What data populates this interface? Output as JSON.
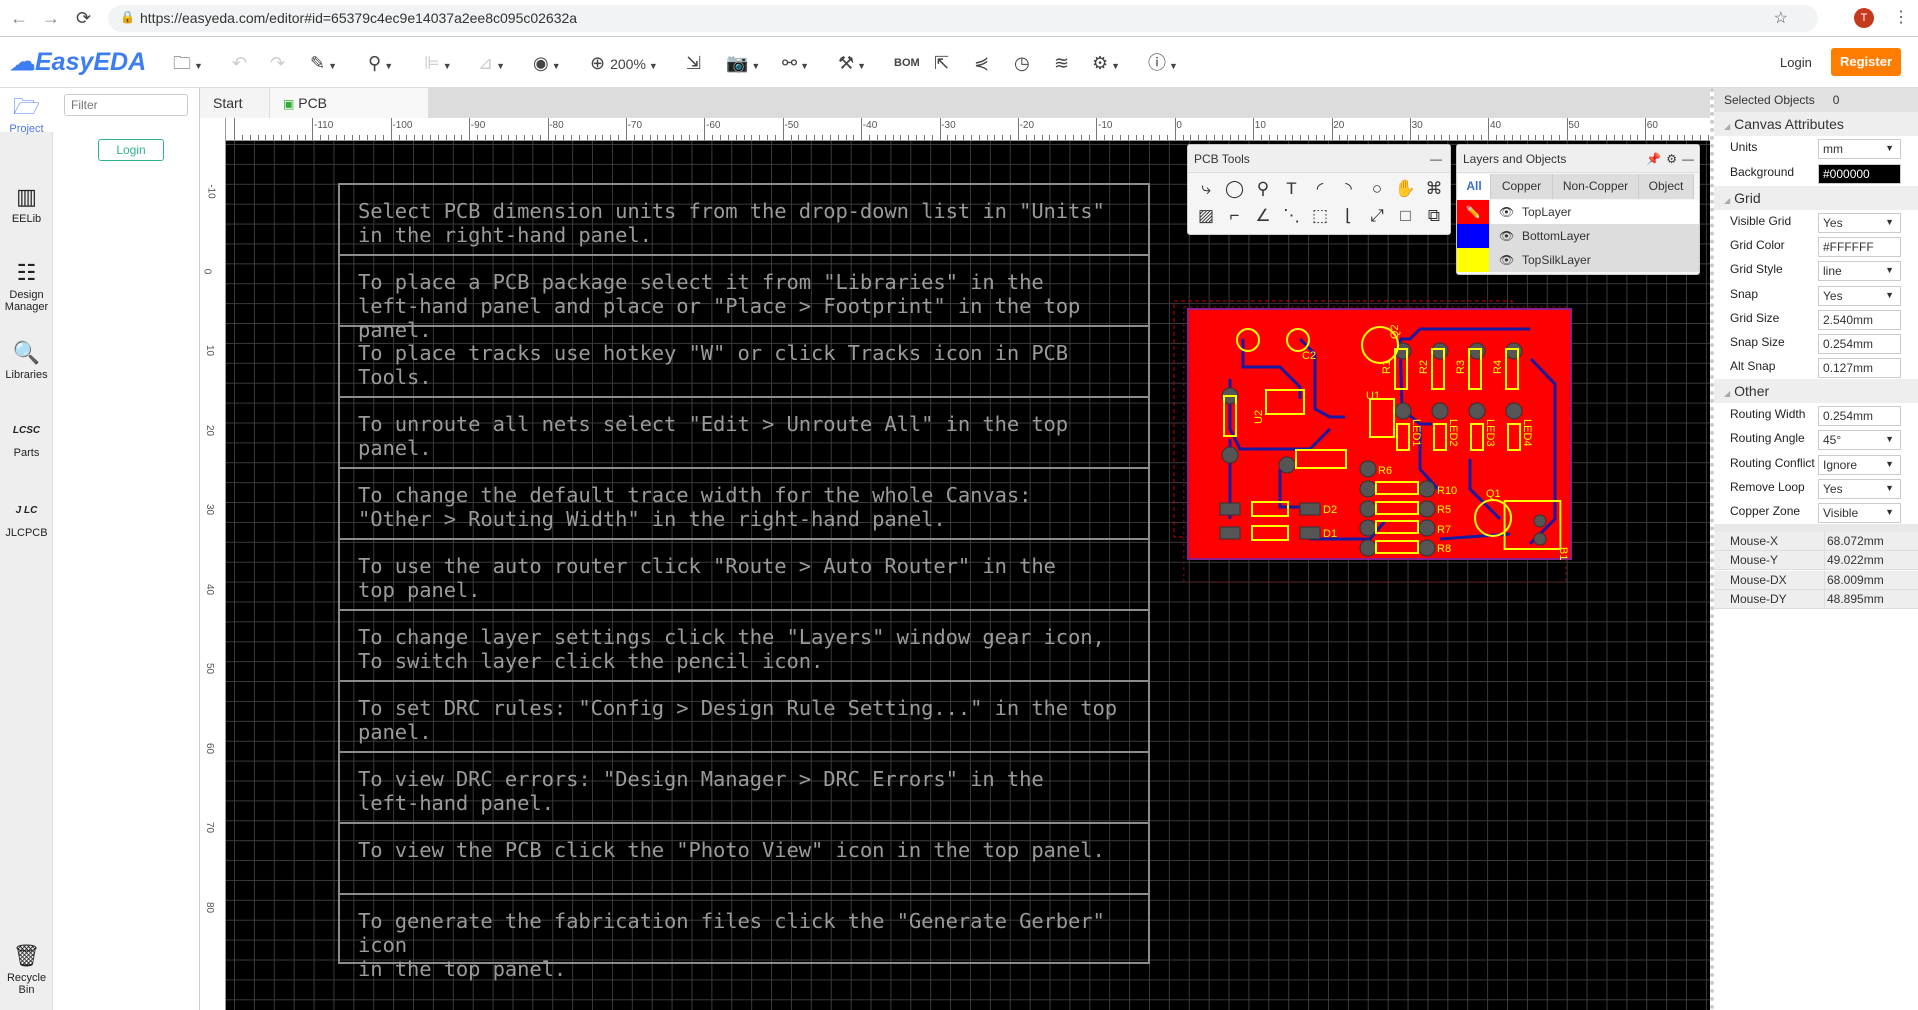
{
  "browser": {
    "url": "https://easyeda.com/editor#id=65379c4ec9e14037a2ee8c095c02632a",
    "avatar": "T"
  },
  "toolbar": {
    "logo": "EasyEDA",
    "zoom": "200%",
    "bom": "BOM",
    "login": "Login",
    "register": "Register"
  },
  "sidebar": {
    "items": [
      {
        "label": "Project",
        "icon": "folder-icon"
      },
      {
        "label": "EELib",
        "icon": "chip-icon"
      },
      {
        "label": "Design Manager",
        "icon": "design-manager-icon"
      },
      {
        "label": "Libraries",
        "icon": "libraries-icon"
      },
      {
        "label": "Parts",
        "icon": "lcsc-icon"
      },
      {
        "label": "JLCPCB",
        "icon": "jlc-icon"
      },
      {
        "label": "Recycle Bin",
        "icon": "trash-icon"
      }
    ],
    "filter_placeholder": "Filter",
    "login": "Login"
  },
  "tabs": [
    {
      "label": "Start"
    },
    {
      "label": "PCB"
    }
  ],
  "ruler": {
    "x_ticks": [
      -110,
      -100,
      -90,
      -80,
      -70,
      -60,
      -50,
      -40,
      -30,
      -20,
      -10,
      0,
      10,
      20,
      30,
      40,
      50,
      60
    ],
    "y_ticks": [
      -10,
      0,
      10,
      20,
      30,
      40,
      50,
      60,
      70,
      80
    ]
  },
  "tips": [
    "Select PCB dimension units from the drop-down list in \"Units\"\nin the right-hand panel.",
    "To place a PCB package select it from \"Libraries\" in the\nleft-hand panel and place or \"Place > Footprint\" in the top panel.",
    "To place tracks use hotkey \"W\" or click Tracks icon in PCB Tools.",
    "To unroute all nets select \"Edit > Unroute All\" in the top panel.",
    "To change the default trace width for the whole Canvas:\n\"Other > Routing Width\" in the right-hand panel.",
    "To use the auto router click \"Route > Auto Router\" in the\ntop panel.",
    "To change layer settings click the \"Layers\" window gear icon,\nTo switch layer click the pencil icon.",
    "To set DRC rules: \"Config > Design Rule Setting...\" in the top\npanel.",
    "To view DRC errors: \"Design Manager > DRC Errors\" in the\nleft-hand panel.",
    "To view the PCB click the \"Photo View\" icon in the top panel.",
    "To generate the fabrication files click the \"Generate Gerber\" icon\nin the top panel."
  ],
  "pcb_tools": {
    "title": "PCB Tools"
  },
  "layers": {
    "title": "Layers and Objects",
    "tabs": [
      "All",
      "Copper",
      "Non-Copper",
      "Object"
    ],
    "rows": [
      {
        "name": "TopLayer",
        "color": "#FF0000"
      },
      {
        "name": "BottomLayer",
        "color": "#0000FF"
      },
      {
        "name": "TopSilkLayer",
        "color": "#FFFF00"
      }
    ]
  },
  "pcb": {
    "labels": [
      "C2",
      "Q2",
      "U1",
      "U2",
      "R1",
      "R2",
      "R3",
      "R4",
      "LED1",
      "LED2",
      "LED3",
      "LED4",
      "R6",
      "R10",
      "R5",
      "R7",
      "R8",
      "D2",
      "D1",
      "Q1",
      "B1"
    ],
    "board_color": "#FF0000",
    "silk_color": "#FFFF00",
    "track_color": "#1a1aa0"
  },
  "right": {
    "selected_label": "Selected Objects",
    "selected_count": "0",
    "canvas_header": "Canvas Attributes",
    "units_label": "Units",
    "units": "mm",
    "background_label": "Background",
    "background": "#000000",
    "grid_header": "Grid",
    "visible_grid_label": "Visible Grid",
    "visible_grid": "Yes",
    "grid_color_label": "Grid Color",
    "grid_color": "#FFFFFF",
    "grid_style_label": "Grid Style",
    "grid_style": "line",
    "snap_label": "Snap",
    "snap": "Yes",
    "grid_size_label": "Grid Size",
    "grid_size": "2.540mm",
    "snap_size_label": "Snap Size",
    "snap_size": "0.254mm",
    "alt_snap_label": "Alt Snap",
    "alt_snap": "0.127mm",
    "other_header": "Other",
    "routing_width_label": "Routing Width",
    "routing_width": "0.254mm",
    "routing_angle_label": "Routing Angle",
    "routing_angle": "45°",
    "routing_conflict_label": "Routing Conflict",
    "routing_conflict": "Ignore",
    "remove_loop_label": "Remove Loop",
    "remove_loop": "Yes",
    "copper_zone_label": "Copper Zone",
    "copper_zone": "Visible",
    "mouse": [
      {
        "k": "Mouse-X",
        "v": "68.072mm"
      },
      {
        "k": "Mouse-Y",
        "v": "49.022mm"
      },
      {
        "k": "Mouse-DX",
        "v": "68.009mm"
      },
      {
        "k": "Mouse-DY",
        "v": "48.895mm"
      }
    ]
  }
}
